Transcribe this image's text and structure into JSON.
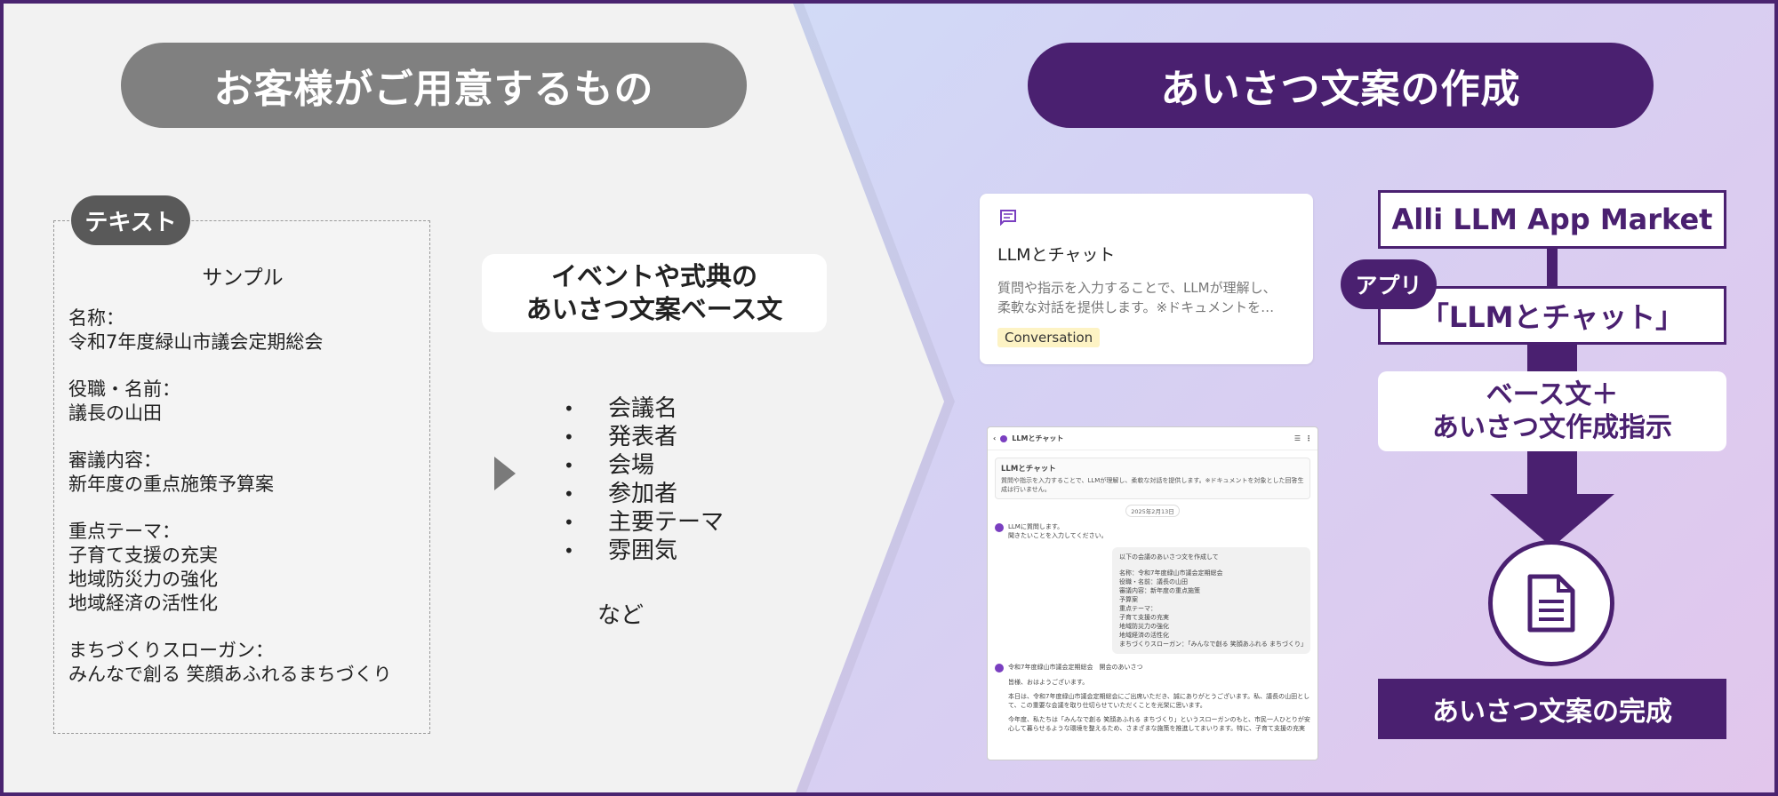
{
  "left_header": "お客様がご用意するもの",
  "right_header": "あいさつ文案の作成",
  "text_card": {
    "tag": "テキスト",
    "title": "サンプル",
    "fields": [
      {
        "label": "名称：",
        "lines": [
          "令和7年度緑山市議会定期総会"
        ]
      },
      {
        "label": "役職・名前：",
        "lines": [
          "議長の山田"
        ]
      },
      {
        "label": "審議内容：",
        "lines": [
          "新年度の重点施策予算案"
        ]
      },
      {
        "label": "重点テーマ：",
        "lines": [
          "子育て支援の充実",
          "地域防災力の強化",
          "地域経済の活性化"
        ]
      },
      {
        "label": "まちづくりスローガン：",
        "lines": [
          "みんなで創る 笑顔あふれるまちづくり"
        ]
      }
    ]
  },
  "base_box": {
    "line1": "イベントや式典の",
    "line2": "あいさつ文案ベース文"
  },
  "bullets": [
    "会議名",
    "発表者",
    "会場",
    "参加者",
    "主要テーマ",
    "雰囲気"
  ],
  "bullets_more": "など",
  "app_card": {
    "title": "LLMとチャット",
    "desc_line1": "質問や指示を入力することで、LLMが理解し、",
    "desc_line2": "柔軟な対話を提供します。※ドキュメントを…",
    "tag": "Conversation"
  },
  "chat": {
    "header_title": "LLMとチャット",
    "info_title": "LLMとチャット",
    "info_desc_1": "質問や指示を入力することで、LLMが理解し、柔軟な対話を提供します。※ドキュメントを対象とした回答生",
    "info_desc_2": "成は行いません。",
    "date": "2025年2月13日",
    "bot_greeting_1": "LLMに質問します。",
    "bot_greeting_2": "聞きたいことを入力してください。",
    "user_lines": [
      "以下の会議のあいさつ文を作成して",
      "",
      "名称：令和7年度緑山市議会定期総会",
      "役職・名前：議長の山田",
      "審議内容：新年度の重点施策",
      "予算案",
      "重点テーマ：",
      "子育て支援の充実",
      "地域防災力の強化",
      "地域経済の活性化",
      "まちづくりスローガン：「みんなで創る 笑顔あふれる まちづくり」"
    ],
    "reply_title": "令和7年度緑山市議会定期総会　開会のあいさつ",
    "reply_p1": "皆様、おはようございます。",
    "reply_p2": "本日は、令和7年度緑山市議会定期総会にご出席いただき、誠にありがとうございます。私、議長の山田として、この重要な会議を取り仕切らせていただくことを光栄に思います。",
    "reply_p3": "今年度、私たちは「みんなで創る 笑顔あふれる まちづくり」というスローガンのもと、市民一人ひとりが安心して暮らせるような環境を整えるため、さまざまな施策を推進してまいります。特に、子育て支援の充実"
  },
  "flow": {
    "market": "Alli LLM App Market",
    "app_tag": "アプリ",
    "app_name": "「LLMとチャット」",
    "instr_line1": "ベース文＋",
    "instr_line2": "あいさつ文作成指示",
    "done": "あいさつ文案の完成"
  },
  "colors": {
    "brand_purple": "#4a2070",
    "gray_pill": "#808080",
    "tag_yellow": "#fdf3c4"
  },
  "icons": [
    "chat-bubble-icon",
    "play-triangle-icon",
    "document-icon",
    "back-chevron-icon",
    "more-vert-icon"
  ]
}
